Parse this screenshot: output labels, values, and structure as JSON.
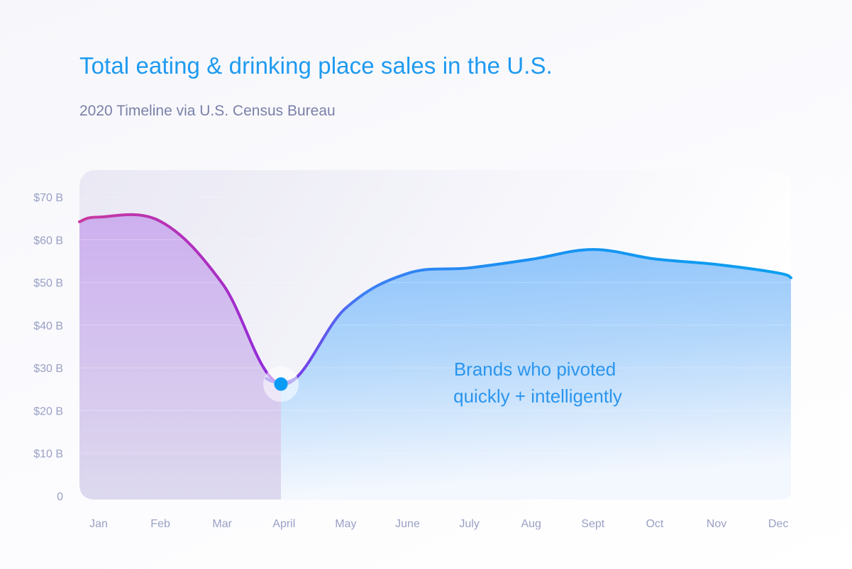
{
  "header": {
    "title": "Total eating & drinking place sales in the U.S.",
    "subtitle": "2020 Timeline via U.S. Census Bureau"
  },
  "colors": {
    "title": "#1e9af0",
    "subtitle": "#7a80a8",
    "line_start": "#c93a9f",
    "line_mid": "#8a2be2",
    "line_end": "#0aa0f0",
    "fill_before": "#cfb4ee",
    "fill_after": "#7fbcfb",
    "highlight_dot": "#0a9cf5",
    "tick_text": "#9aa0c4",
    "annotation": "#2a95ef"
  },
  "chart_data": {
    "type": "area",
    "title": "Total eating & drinking place sales in the U.S.",
    "subtitle": "2020 Timeline via U.S. Census Bureau",
    "xlabel": "",
    "ylabel": "",
    "categories": [
      "Jan",
      "Feb",
      "Mar",
      "April",
      "May",
      "June",
      "July",
      "Aug",
      "Sept",
      "Oct",
      "Nov",
      "Dec"
    ],
    "series": [
      {
        "name": "Sales",
        "values": [
          65.3,
          64.3,
          49.8,
          26.2,
          44.0,
          52.1,
          53.4,
          55.4,
          57.7,
          55.5,
          54.2,
          52.2
        ]
      }
    ],
    "start_value": 64.2,
    "end_value": 51.1,
    "ylim": [
      0,
      70
    ],
    "yticks": [
      {
        "value": 0,
        "label": "0"
      },
      {
        "value": 10,
        "label": "$10 B"
      },
      {
        "value": 20,
        "label": "$20 B"
      },
      {
        "value": 30,
        "label": "$30 B"
      },
      {
        "value": 40,
        "label": "$40 B"
      },
      {
        "value": 50,
        "label": "$50 B"
      },
      {
        "value": 60,
        "label": "$60 B"
      },
      {
        "value": 70,
        "label": "$70 B"
      }
    ],
    "grid": true,
    "highlight": {
      "category": "April",
      "value": 26.2
    },
    "annotation": {
      "lines": [
        "Brands who pivoted",
        "quickly + intelligently"
      ],
      "region": "after April"
    },
    "legend": "none"
  }
}
